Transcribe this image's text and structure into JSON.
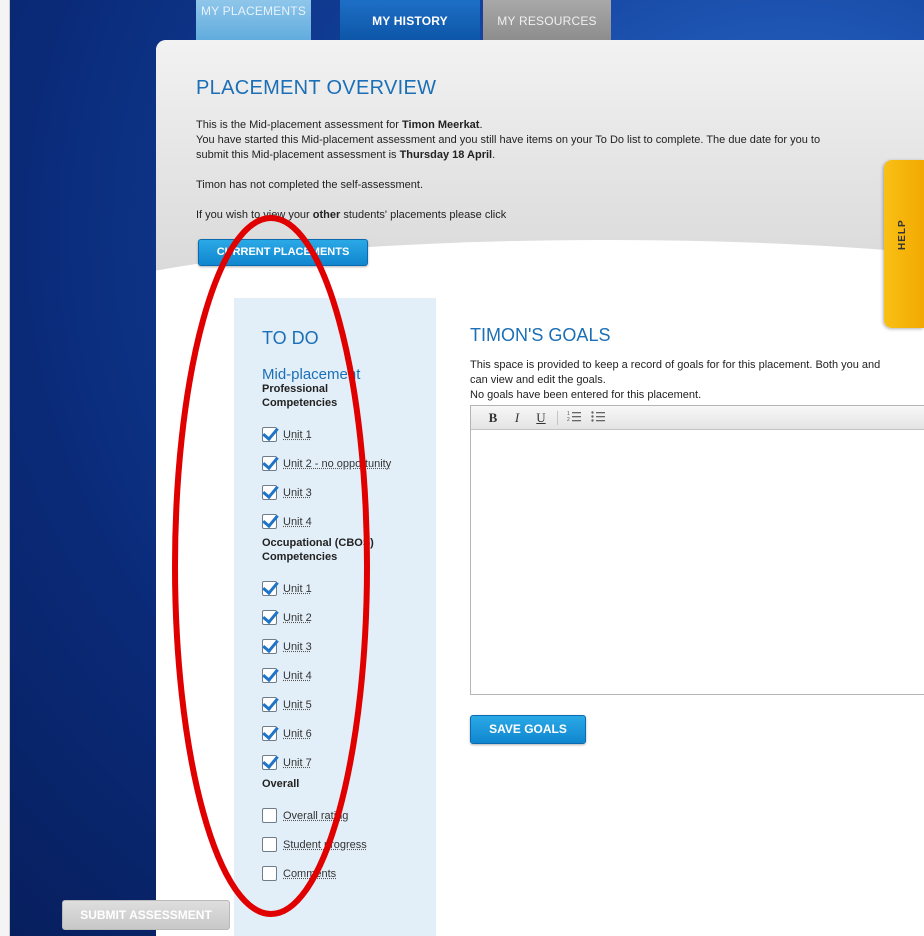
{
  "tabs": {
    "placements": "MY PLACEMENTS",
    "history": "MY HISTORY",
    "resources": "MY RESOURCES"
  },
  "overview": {
    "title": "PLACEMENT OVERVIEW",
    "line1_pre": "This is the Mid-placement assessment for ",
    "student_name": "Timon Meerkat",
    "line1_post": ".",
    "line2_pre": "You have started this Mid-placement assessment and you still have items on your To Do list to complete. The due date for you to submit this Mid-placement assessment is ",
    "due_date": "Thursday 18 April",
    "line2_post": ".",
    "line3": "Timon has not completed the self-assessment.",
    "line4_pre": "If you wish to view your ",
    "line4_bold": "other",
    "line4_post": " students' placements please click",
    "current_button": "CURRENT PLACEMENTS"
  },
  "help": {
    "label": "HELP"
  },
  "todo": {
    "title": "TO DO",
    "subtitle": "Mid-placement",
    "sections": [
      {
        "label": "Professional Competencies",
        "items": [
          {
            "label": "Unit 1",
            "checked": true
          },
          {
            "label": "Unit 2 - no opportunity",
            "checked": true
          },
          {
            "label": "Unit 3",
            "checked": true
          },
          {
            "label": "Unit 4",
            "checked": true
          }
        ]
      },
      {
        "label": "Occupational (CBOS) Competencies",
        "items": [
          {
            "label": "Unit 1",
            "checked": true
          },
          {
            "label": "Unit 2",
            "checked": true
          },
          {
            "label": "Unit 3",
            "checked": true
          },
          {
            "label": "Unit 4",
            "checked": true
          },
          {
            "label": "Unit 5",
            "checked": true
          },
          {
            "label": "Unit 6",
            "checked": true
          },
          {
            "label": "Unit 7",
            "checked": true
          }
        ]
      },
      {
        "label": "Overall",
        "items": [
          {
            "label": "Overall rating",
            "checked": false
          },
          {
            "label": "Student progress",
            "checked": false
          },
          {
            "label": "Comments",
            "checked": false
          }
        ]
      }
    ],
    "submit_button": "SUBMIT ASSESSMENT"
  },
  "goals": {
    "title": "TIMON'S GOALS",
    "desc1": "This space is provided to keep a record of goals for for this placement. Both you and can view and edit the goals.",
    "desc2": "No goals have been entered for this placement.",
    "toolbar": {
      "bold": "B",
      "italic": "I",
      "underline": "U",
      "ordered_list": "⅓",
      "bullet_list": "☰"
    },
    "save_button": "SAVE GOALS"
  },
  "colors": {
    "accent": "#1b6fb6",
    "annotation": "#e00000",
    "help": "#f5b400"
  }
}
